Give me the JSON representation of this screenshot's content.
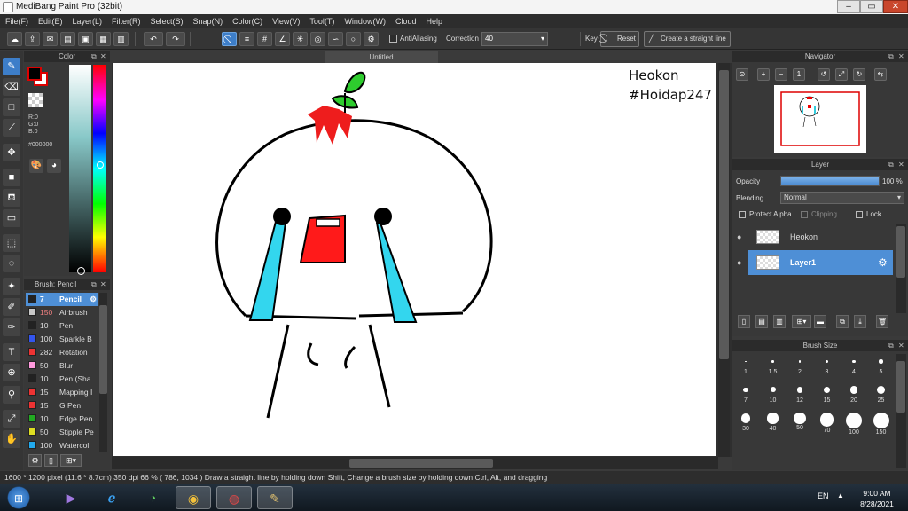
{
  "window": {
    "title": "MediBang Paint Pro (32bit)",
    "controls": [
      "–",
      "▭",
      "✕"
    ]
  },
  "menu": [
    "File(F)",
    "Edit(E)",
    "Layer(L)",
    "Filter(R)",
    "Select(S)",
    "Snap(N)",
    "Color(C)",
    "View(V)",
    "Tool(T)",
    "Window(W)",
    "Cloud",
    "Help"
  ],
  "toolbar": {
    "antialiasing_label": "AntiAliasing",
    "correction_label": "Correction",
    "correction_value": "40",
    "key_label": "Key",
    "reset_label": "Reset",
    "straight_line_label": "Create a straight line"
  },
  "color_panel": {
    "title": "Color",
    "r": "R:0",
    "g": "G:0",
    "b": "B:0",
    "hex": "#000000",
    "foreground": "#000000"
  },
  "brush_panel": {
    "title": "Brush: Pencil",
    "brushes": [
      {
        "size": "7",
        "name": "Pencil",
        "color": "#222222",
        "selected": true
      },
      {
        "size": "150",
        "name": "Airbrush",
        "color": "#c8c8c8",
        "selected": false
      },
      {
        "size": "10",
        "name": "Pen",
        "color": "#222222",
        "selected": false
      },
      {
        "size": "100",
        "name": "Sparkle B",
        "color": "#3355ee",
        "selected": false
      },
      {
        "size": "282",
        "name": "Rotation",
        "color": "#ee3333",
        "selected": false
      },
      {
        "size": "50",
        "name": "Blur",
        "color": "#ff99dd",
        "selected": false
      },
      {
        "size": "10",
        "name": "Pen (Sha",
        "color": "#222222",
        "selected": false
      },
      {
        "size": "15",
        "name": "Mapping I",
        "color": "#ee3333",
        "selected": false
      },
      {
        "size": "15",
        "name": "G Pen",
        "color": "#ee3333",
        "selected": false
      },
      {
        "size": "10",
        "name": "Edge Pen",
        "color": "#22aa22",
        "selected": false
      },
      {
        "size": "50",
        "name": "Stipple Pe",
        "color": "#dddd22",
        "selected": false
      },
      {
        "size": "100",
        "name": "Watercol",
        "color": "#22aaee",
        "selected": false
      }
    ]
  },
  "canvas": {
    "tab_title": "Untitled",
    "watermark_line1": "Heokon",
    "watermark_line2": "#Hoidap247"
  },
  "navigator": {
    "title": "Navigator"
  },
  "layer_panel": {
    "title": "Layer",
    "opacity_label": "Opacity",
    "opacity_value": "100 %",
    "opacity": 1.0,
    "blending_label": "Blending",
    "blending_value": "Normal",
    "protect_alpha_label": "Protect Alpha",
    "clipping_label": "Clipping",
    "lock_label": "Lock",
    "layers": [
      {
        "name": "Heokon",
        "selected": false
      },
      {
        "name": "Layer1",
        "selected": true
      }
    ]
  },
  "brush_size_panel": {
    "title": "Brush Size",
    "sizes": [
      "1",
      "1.5",
      "2",
      "3",
      "4",
      "5",
      "7",
      "10",
      "12",
      "15",
      "20",
      "25",
      "30",
      "40",
      "50",
      "70",
      "100",
      "150"
    ]
  },
  "status": {
    "text": "1600 * 1200 pixel   (11.6 * 8.7cm)   350 dpi   66 %   ( 786, 1034 )   Draw a straight line by holding down Shift, Change a brush size by holding down Ctrl, Alt, and dragging"
  },
  "taskbar": {
    "lang": "EN",
    "time": "9:00 AM",
    "date": "8/28/2021"
  }
}
